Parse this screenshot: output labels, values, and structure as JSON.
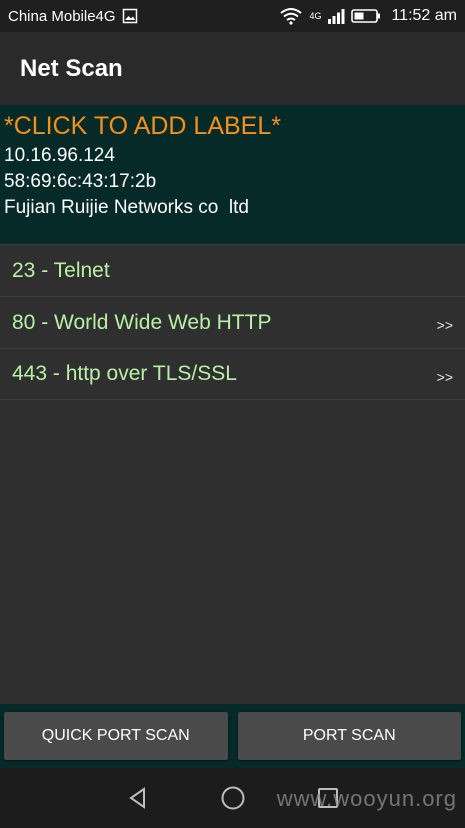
{
  "status_bar": {
    "carrier": "China Mobile4G",
    "network_type": "4G",
    "time": "11:52 am",
    "icons": [
      "image-icon",
      "wifi-icon",
      "signal-icon",
      "battery-icon"
    ]
  },
  "app": {
    "title": "Net Scan"
  },
  "device": {
    "label": "*CLICK TO ADD LABEL*",
    "ip": "10.16.96.124",
    "mac": "58:69:6c:43:17:2b",
    "vendor": "Fujian Ruijie Networks co  ltd"
  },
  "ports": [
    {
      "text": "23 - Telnet",
      "chevron": ""
    },
    {
      "text": "80 - World Wide Web HTTP",
      "chevron": ">>"
    },
    {
      "text": "443 - http over TLS/SSL",
      "chevron": ">>"
    }
  ],
  "buttons": {
    "quick_scan": "QUICK PORT SCAN",
    "port_scan": "PORT SCAN"
  },
  "nav": {
    "icons": [
      "back-icon",
      "home-icon",
      "recents-icon"
    ]
  },
  "watermark": "www.wooyun.org",
  "colors": {
    "label_orange": "#f5901c",
    "port_green": "#b8f0a6",
    "panel_bg": "#052a28"
  }
}
